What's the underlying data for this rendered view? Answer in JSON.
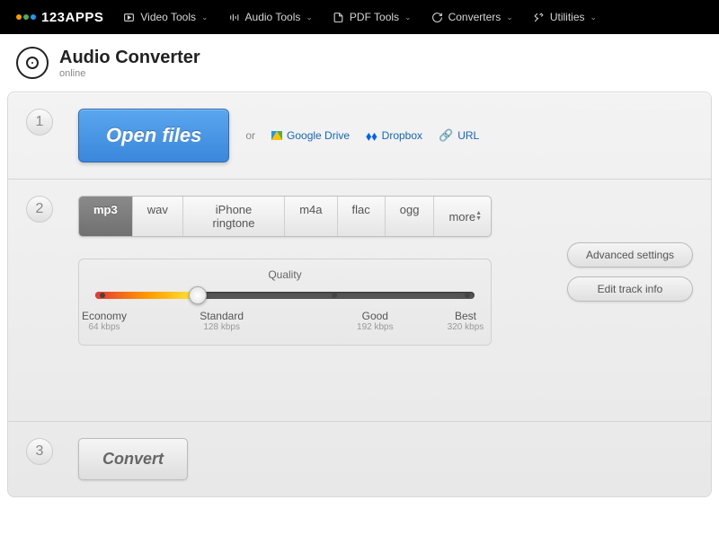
{
  "brand": "123APPS",
  "nav": [
    {
      "label": "Video Tools",
      "icon": "play"
    },
    {
      "label": "Audio Tools",
      "icon": "eq"
    },
    {
      "label": "PDF Tools",
      "icon": "doc"
    },
    {
      "label": "Converters",
      "icon": "refresh"
    },
    {
      "label": "Utilities",
      "icon": "tools"
    }
  ],
  "page": {
    "title": "Audio Converter",
    "subtitle": "online"
  },
  "step1": {
    "open": "Open files",
    "or": "or",
    "sources": [
      {
        "label": "Google Drive",
        "icon": "gdrive"
      },
      {
        "label": "Dropbox",
        "icon": "dropbox"
      },
      {
        "label": "URL",
        "icon": "link"
      }
    ]
  },
  "step2": {
    "tabs": [
      "mp3",
      "wav",
      "iPhone ringtone",
      "m4a",
      "flac",
      "ogg",
      "more"
    ],
    "active": 0,
    "quality": {
      "title": "Quality",
      "stops": [
        {
          "name": "Economy",
          "rate": "64 kbps",
          "pos": 2
        },
        {
          "name": "Standard",
          "rate": "128 kbps",
          "pos": 27
        },
        {
          "name": "Good",
          "rate": "192 kbps",
          "pos": 63
        },
        {
          "name": "Best",
          "rate": "320 kbps",
          "pos": 98
        }
      ],
      "value": 1
    },
    "side": [
      "Advanced settings",
      "Edit track info"
    ]
  },
  "step3": {
    "convert": "Convert"
  }
}
